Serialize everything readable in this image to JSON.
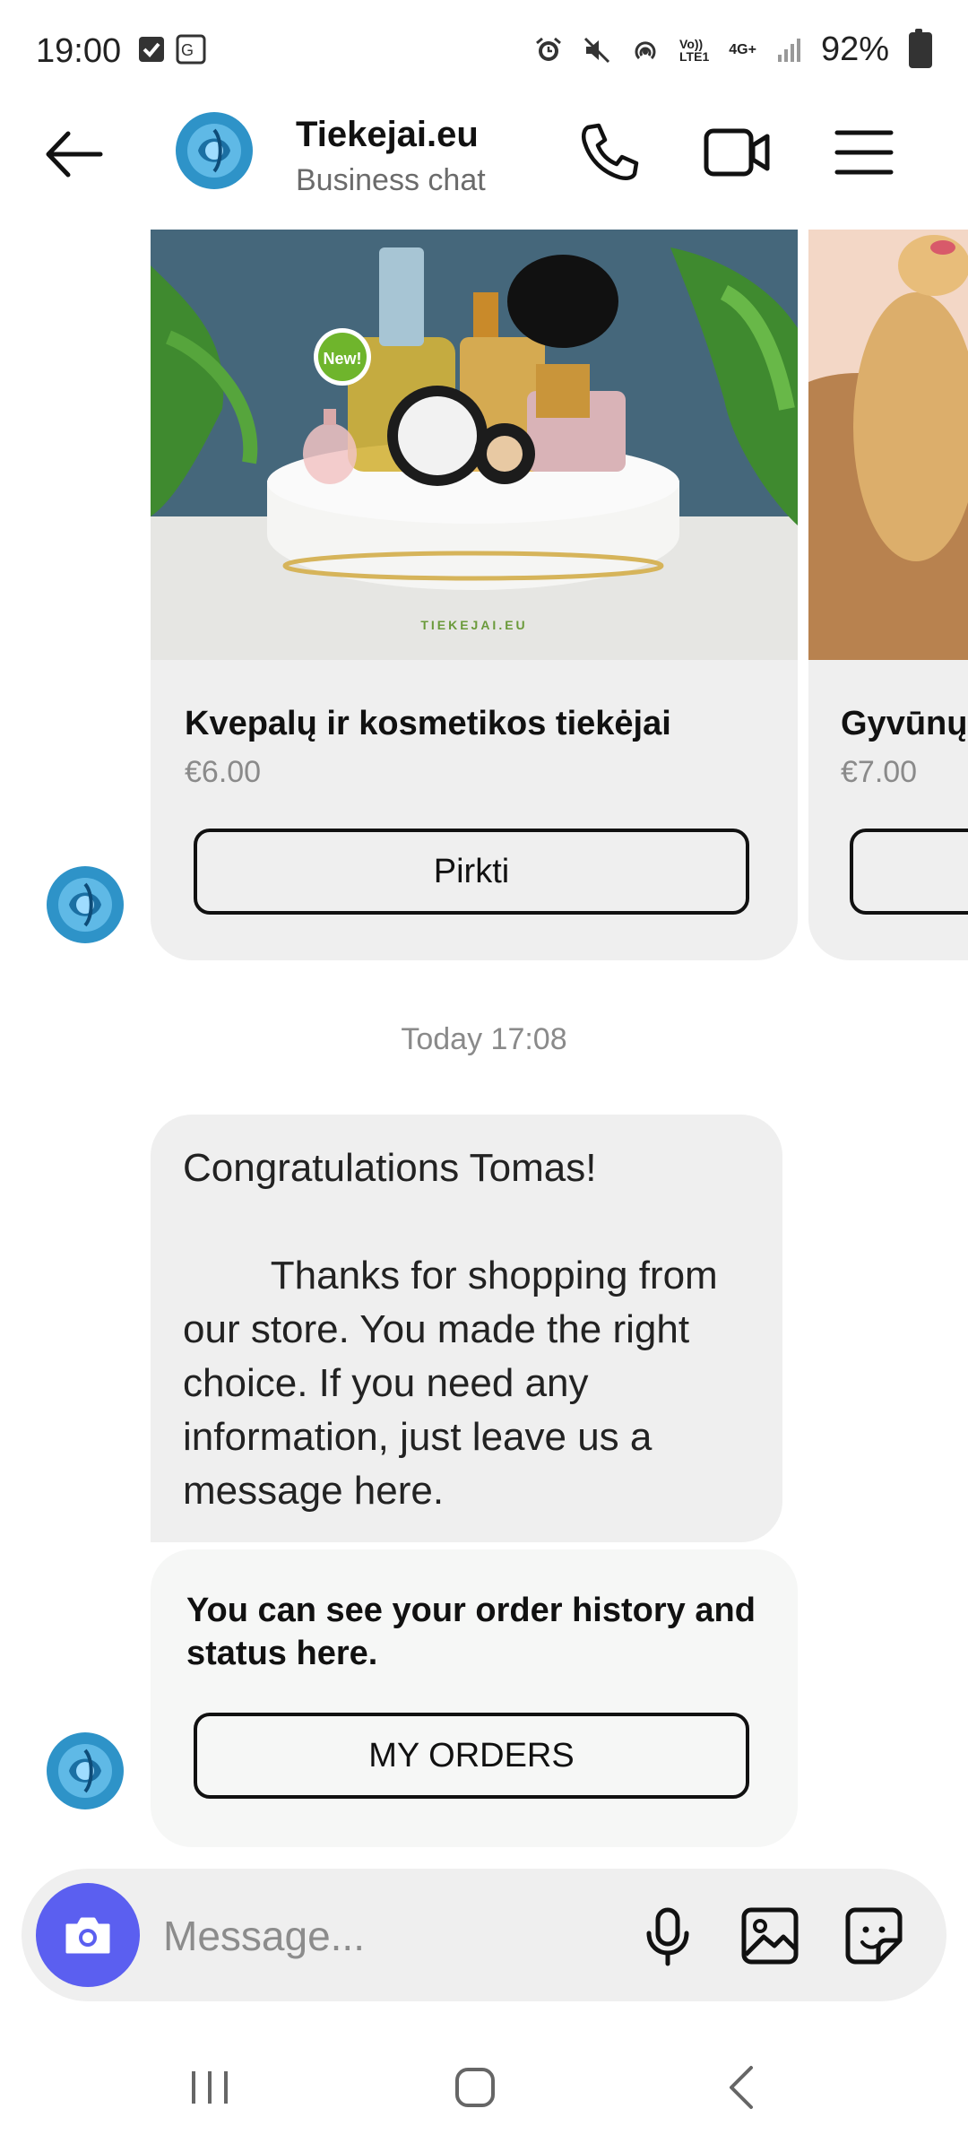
{
  "status_bar": {
    "time": "19:00",
    "battery": "92%",
    "volte": "Vo))\nLTE1",
    "network": "4G+"
  },
  "header": {
    "title": "Tiekejai.eu",
    "subtitle": "Business chat"
  },
  "carousel": {
    "cards": [
      {
        "title": "Kvepalų ir kosmetikos tiekėjai",
        "price": "€6.00",
        "button": "Pirkti",
        "badge": "New!",
        "watermark": "TIEKEJAI.EU"
      },
      {
        "title": "Gyvūnų",
        "price": "€7.00"
      }
    ]
  },
  "chat": {
    "timestamp": "Today 17:08",
    "message": "Congratulations Tomas!\n\n        Thanks for shopping from our store. You made the right choice. If you need any information, just leave us a message here.",
    "orders": {
      "text": "You can see your order history and status here.",
      "button": "MY ORDERS"
    }
  },
  "composer": {
    "placeholder": "Message..."
  },
  "colors": {
    "accent": "#5b5ff0",
    "bubble": "#efefef",
    "avatar": "#2e93c8"
  }
}
